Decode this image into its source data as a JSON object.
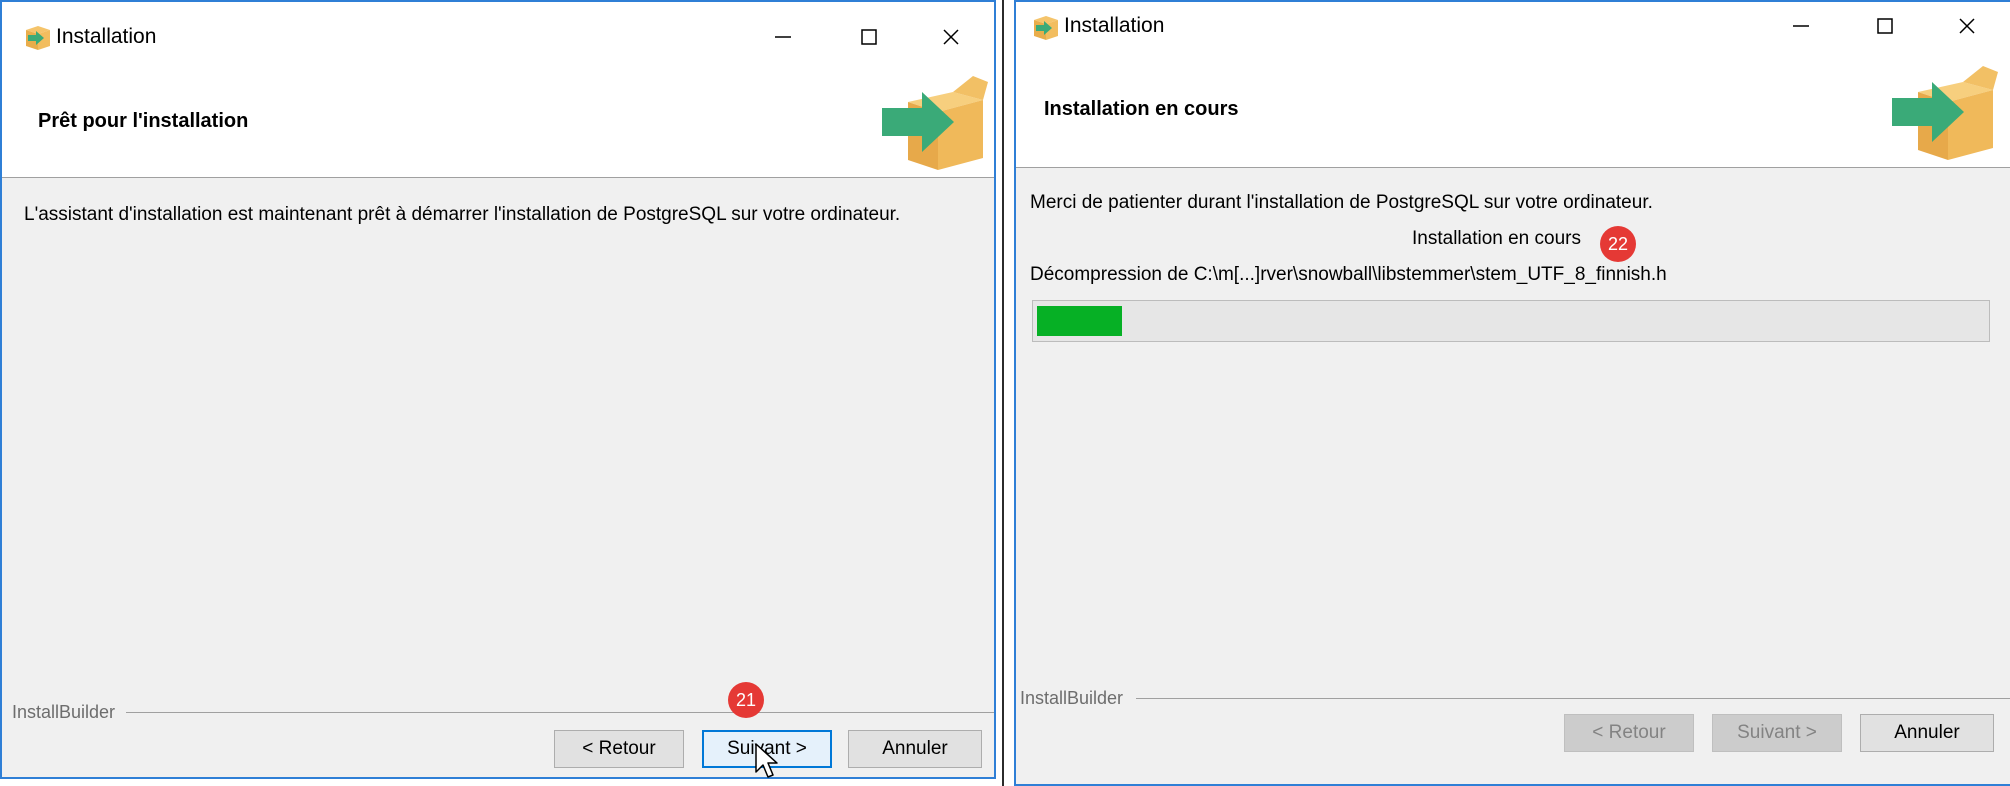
{
  "windows": [
    {
      "title": "Installation",
      "header_title": "Prêt pour l'installation",
      "intro_text": "L'assistant d'installation est maintenant prêt à démarrer l'installation de PostgreSQL sur votre ordinateur.",
      "footer_brand": "InstallBuilder",
      "buttons": {
        "back": "< Retour",
        "next": "Suivant >",
        "cancel": "Annuler"
      },
      "step_badge": "21"
    },
    {
      "title": "Installation",
      "header_title": "Installation en cours",
      "intro_text": "Merci de patienter durant l'installation de PostgreSQL sur votre ordinateur.",
      "status_text": "Installation en cours",
      "file_text": "Décompression de C:\\m[...]rver\\snowball\\libstemmer\\stem_UTF_8_finnish.h",
      "progress": 0.09,
      "footer_brand": "InstallBuilder",
      "buttons": {
        "back": "< Retour",
        "next": "Suivant >",
        "cancel": "Annuler"
      },
      "step_badge": "22"
    }
  ],
  "colors": {
    "window_border": "#2f7fd6",
    "progress_fill": "#06b025",
    "badge": "#e53935",
    "focus_border": "#0078d7"
  },
  "icons": [
    "installer-app-icon",
    "minimize-icon",
    "maximize-icon",
    "close-icon",
    "box-arrow-icon",
    "mouse-cursor-icon"
  ]
}
